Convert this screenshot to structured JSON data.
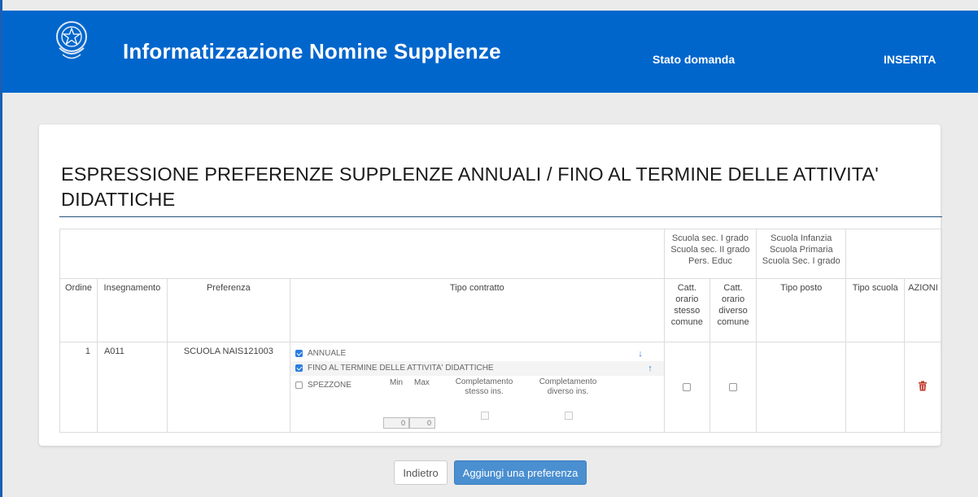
{
  "header": {
    "app_title": "Informatizzazione Nomine Supplenze",
    "status_label": "Stato domanda",
    "status_value": "INSERITA",
    "emblem_icon": "italian-republic-emblem"
  },
  "section": {
    "title": "ESPRESSIONE PREFERENZE SUPPLENZE ANNUALI / FINO AL TERMINE DELLE ATTIVITA' DIDATTICHE"
  },
  "table": {
    "group_headers": {
      "catt": "Scuola sec. I grado Scuola sec. II grado Pers. Educ",
      "tipo_posto": "Scuola Infanzia Scuola Primaria Scuola Sec. I grado"
    },
    "columns": {
      "ordine": "Ordine",
      "insegnamento": "Insegnamento",
      "preferenza": "Preferenza",
      "tipo_contratto": "Tipo contratto",
      "catt_stesso": "Catt. orario stesso comune",
      "catt_diverso": "Catt. orario diverso comune",
      "tipo_posto": "Tipo posto",
      "tipo_scuola": "Tipo scuola",
      "azioni": "AZIONI"
    },
    "rows": [
      {
        "ordine": "1",
        "insegnamento": "A011",
        "preferenza": "SCUOLA NAIS121003",
        "contratti": [
          {
            "label": "ANNUALE",
            "checked": true,
            "arrow": "↓"
          },
          {
            "label": "FINO AL TERMINE DELLE ATTIVITA' DIDATTICHE",
            "checked": true,
            "arrow": "↑"
          }
        ],
        "spezzone": {
          "label": "SPEZZONE",
          "checked": false,
          "min_label": "Min",
          "max_label": "Max",
          "min_value": "0",
          "max_value": "0",
          "completamento_stesso": "Completamento stesso ins.",
          "completamento_diverso": "Completamento diverso ins."
        },
        "catt_stesso_checked": false,
        "catt_diverso_checked": false,
        "action_icon": "trash-icon"
      }
    ]
  },
  "buttons": {
    "back": "Indietro",
    "add": "Aggiungi una preferenza"
  },
  "colors": {
    "header_bg": "#0066cc",
    "primary_button": "#4a8fd0",
    "delete_icon": "#c0392b"
  }
}
